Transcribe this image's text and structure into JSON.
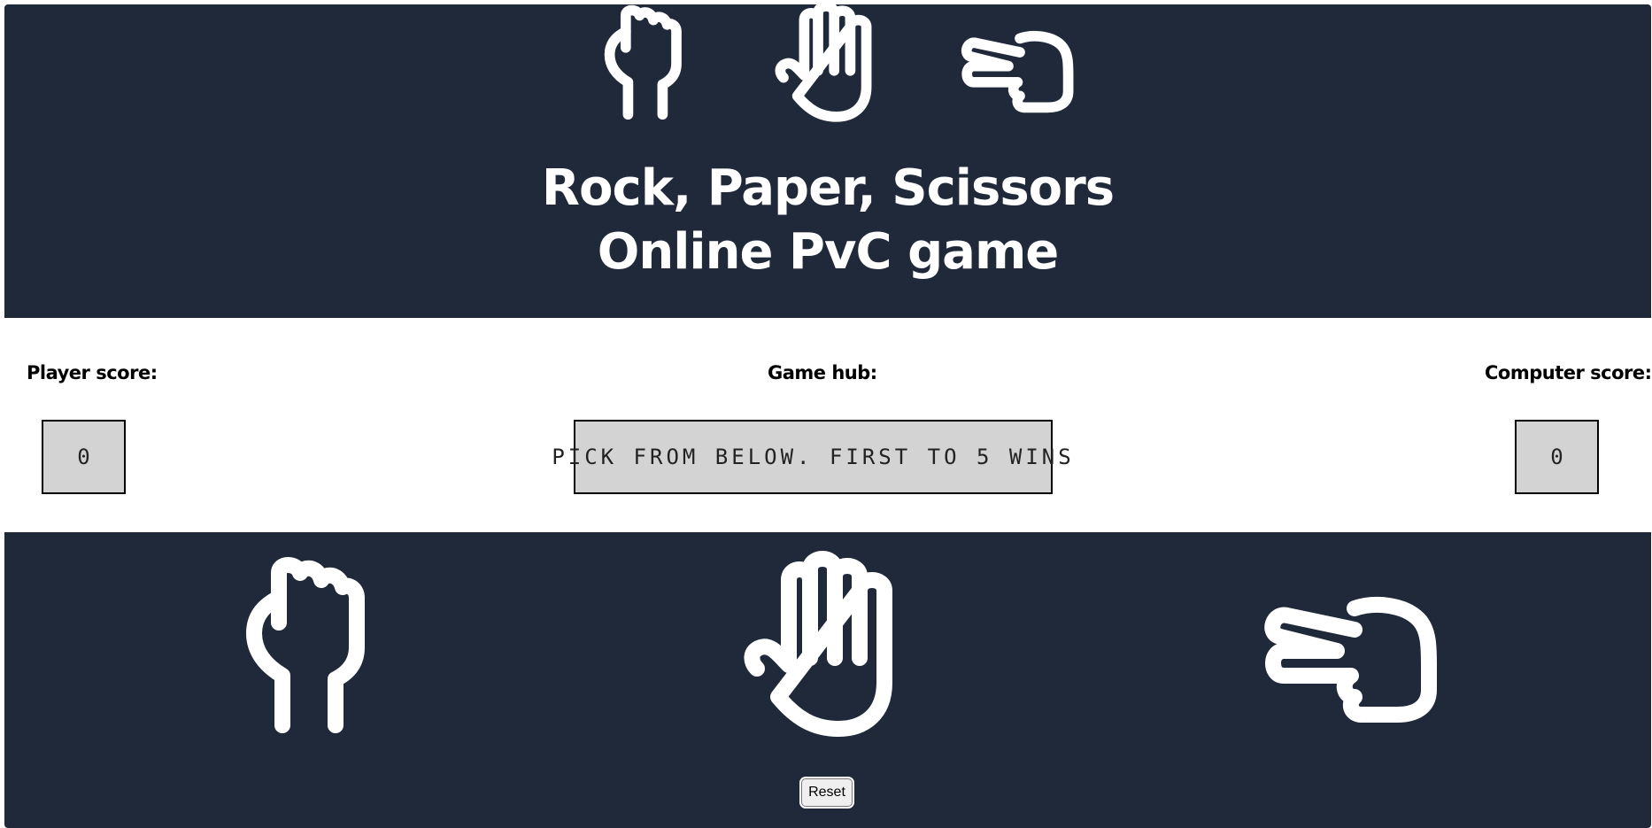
{
  "title": {
    "line1": "Rock, Paper, Scissors",
    "line2": "Online PvC game"
  },
  "scores": {
    "player_label": "Player score:",
    "player_value": "0",
    "hub_label": "Game hub:",
    "hub_message": "PICK FROM BELOW. FIRST TO 5 WINS",
    "computer_label": "Computer score:",
    "computer_value": "0"
  },
  "choices": [
    "rock",
    "paper",
    "scissors"
  ],
  "controls": {
    "reset_label": "Reset"
  },
  "colors": {
    "header_bg": "#20293a",
    "hand_stroke": "#ffffff",
    "box_bg": "#d3d3d3"
  }
}
